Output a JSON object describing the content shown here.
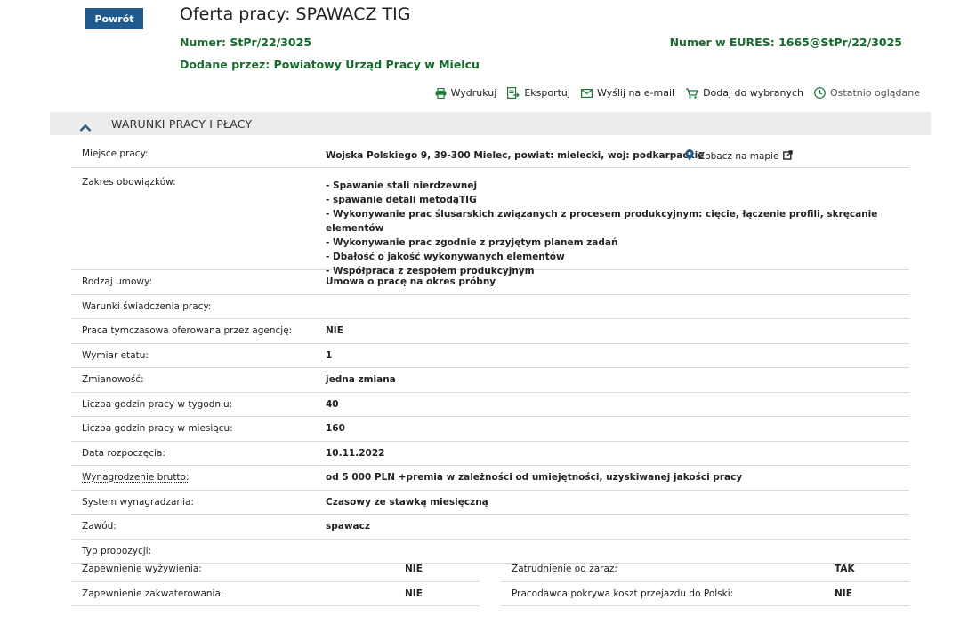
{
  "header": {
    "back_label": "Powrót",
    "title": "Oferta pracy: SPAWACZ TIG",
    "number_label": "Numer:",
    "number_value": "StPr/22/3025",
    "eures_label": "Numer w EURES:",
    "eures_value": "1665@StPr/22/3025",
    "added_label": "Dodane przez:",
    "added_value": "Powiatowy Urząd Pracy w Mielcu"
  },
  "toolbar": {
    "print": "Wydrukuj",
    "export": "Eksportuj",
    "email": "Wyślij na e-mail",
    "favorites": "Dodaj do wybranych",
    "recent": "Ostatnio oglądane"
  },
  "section": {
    "title": "WARUNKI PRACY I PŁACY"
  },
  "details": {
    "location_label": "Miejsce pracy:",
    "location_value": "Wojska Polskiego 9, 39-300 Mielec, powiat: mielecki, woj: podkarpackie",
    "map_link": "Zobacz na mapie",
    "duties_label": "Zakres obowiązków:",
    "duties": [
      "- Spawanie stali nierdzewnej",
      "- spawanie detali metodąTIG",
      "- Wykonywanie prac ślusarskich związanych z procesem produkcyjnym: cięcie, łączenie profili, skręcanie elementów",
      "- Wykonywanie prac zgodnie z przyjętym planem zadań",
      "- Dbałość o jakość wykonywanych elementów",
      "- Współpraca z zespołem produkcyjnym"
    ],
    "rows": [
      {
        "label": "Rodzaj umowy:",
        "value": "Umowa o pracę na okres próbny"
      },
      {
        "label": "Warunki świadczenia pracy:",
        "value": ""
      },
      {
        "label": "Praca tymczasowa oferowana przez agencję:",
        "value": "NIE"
      },
      {
        "label": "Wymiar etatu:",
        "value": "1"
      },
      {
        "label": "Zmianowość:",
        "value": "jedna zmiana"
      },
      {
        "label": "Liczba godzin pracy w tygodniu:",
        "value": "40"
      },
      {
        "label": "Liczba godzin pracy w miesiącu:",
        "value": "160"
      },
      {
        "label": "Data rozpoczęcia:",
        "value": "10.11.2022"
      },
      {
        "label": "Wynagrodzenie brutto:",
        "value": "od 5 000 PLN +premia w zależności od umiejętności, uzyskiwanej jakości pracy"
      },
      {
        "label": "System wynagradzania:",
        "value": "Czasowy ze stawką miesięczną"
      },
      {
        "label": "Zawód:",
        "value": "spawacz"
      },
      {
        "label": "Typ propozycji:",
        "value": ""
      }
    ],
    "left_pairs": [
      {
        "label": "Zapewnienie wyżywienia:",
        "value": "NIE"
      },
      {
        "label": "Zapewnienie zakwaterowania:",
        "value": "NIE"
      }
    ],
    "right_pairs": [
      {
        "label": "Zatrudnienie od zaraz:",
        "value": "TAK"
      },
      {
        "label": "Pracodawca pokrywa koszt przejazdu do Polski:",
        "value": "NIE"
      }
    ]
  }
}
